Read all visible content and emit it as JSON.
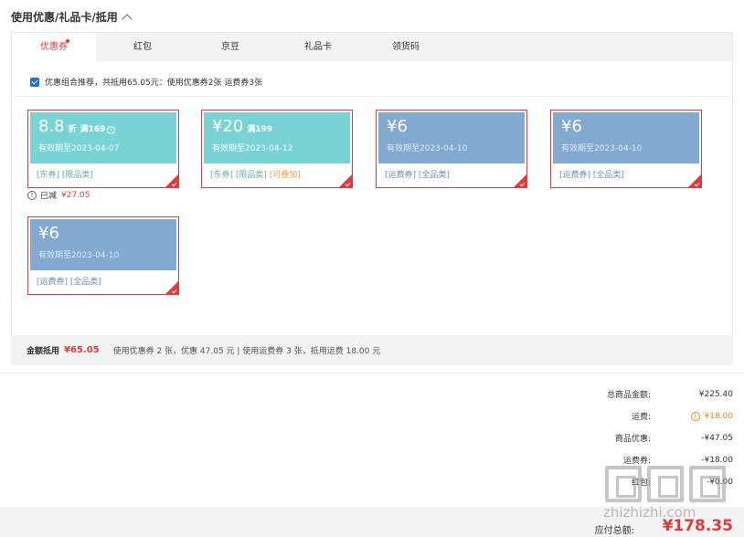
{
  "section_title": "使用优惠/礼品卡/抵用",
  "tabs": [
    {
      "label": "优惠券",
      "active": true,
      "dot": true
    },
    {
      "label": "红包"
    },
    {
      "label": "京豆"
    },
    {
      "label": "礼品卡"
    },
    {
      "label": "领货码"
    }
  ],
  "recommend_text": "优惠组合推荐，共抵用65.05元：使用优惠券2张 运费券3张",
  "coupons": [
    {
      "amount": "8.8",
      "unit": "折",
      "condition": "满169",
      "expiry": "有效期至2023-04-07",
      "tags": [
        "[东券]",
        "[限品类]"
      ]
    },
    {
      "amount": "¥20",
      "condition": "满199",
      "expiry": "有效期至2023-04-12",
      "tags": [
        "[东券]",
        "[限品类]",
        "[可叠加]"
      ]
    },
    {
      "amount": "¥6",
      "expiry": "有效期至2023-04-10",
      "tags": [
        "[运费券]",
        "[全品类]"
      ]
    },
    {
      "amount": "¥6",
      "expiry": "有效期至2023-04-10",
      "tags": [
        "[运费券]",
        "[全品类]"
      ]
    },
    {
      "amount": "¥6",
      "expiry": "有效期至2023-04-10",
      "tags": [
        "[运费券]",
        "[全品类]"
      ]
    }
  ],
  "reduced": {
    "label": "已减",
    "value": "¥27.05"
  },
  "summary": {
    "label": "金额抵用",
    "value": "¥65.05",
    "detail": "使用优惠券 2 张，优惠 47.05 元 | 使用运费券 3 张，抵用运费 18.00 元"
  },
  "totals": [
    {
      "label": "总商品金额:",
      "value": "¥225.40"
    },
    {
      "label": "运费:",
      "value": "¥18.00",
      "info": true
    },
    {
      "label": "商品优惠:",
      "value": "-¥47.05"
    },
    {
      "label": "运费券:",
      "value": "-¥18.00"
    },
    {
      "label": "红包:",
      "value": "-¥0.00"
    }
  ],
  "payable": {
    "label": "应付总额:",
    "value": "¥178.35"
  },
  "watermark": "zhizhizhi.com",
  "colors": {
    "accent": "#e4393c",
    "teal": "#78d3d5",
    "blue": "#82a9cf",
    "orange": "#e8890c"
  }
}
